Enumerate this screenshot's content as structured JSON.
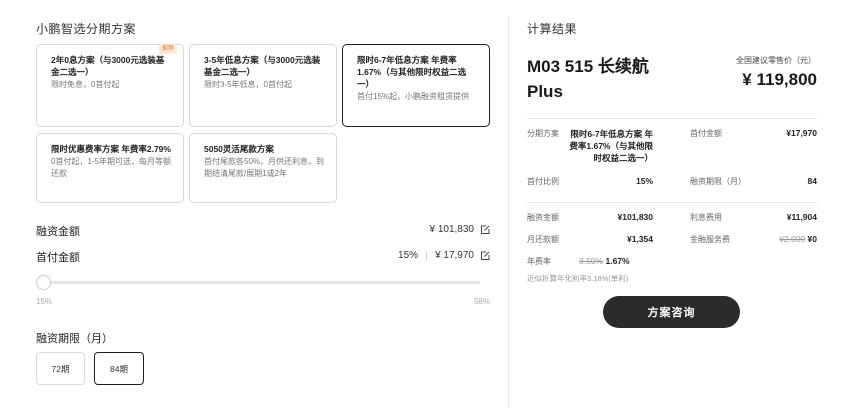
{
  "plans_section": {
    "title": "小鹏智选分期方案",
    "plans": [
      {
        "title": "2年0息方案（与3000元选装基金二选一）",
        "desc": "限时免息，0首付起",
        "badge": "推荐",
        "selected": false
      },
      {
        "title": "3-5年低息方案（与3000元选装基金二选一）",
        "desc": "限时3-5年低息，0首付起",
        "selected": false
      },
      {
        "title": "限时6-7年低息方案 年费率1.67%（与其他限时权益二选一）",
        "desc": "首付15%起，小鹏融资租赁提供",
        "selected": true
      },
      {
        "title": "限时优惠费率方案 年费率2.79%",
        "desc": "0首付起，1-5年期可选，每月等额还款",
        "selected": false
      },
      {
        "title": "5050灵活尾款方案",
        "desc": "首付尾款各50%，月供还利息，到期结清尾款/展期1或2年",
        "selected": false
      }
    ]
  },
  "financing": {
    "amount_label": "融资金额",
    "amount_value": "¥ 101,830",
    "down_label": "首付金额",
    "down_percent": "15%",
    "down_value": "¥ 17,970",
    "slider_level": 0,
    "slider_min": "15%",
    "slider_max": "58%"
  },
  "term": {
    "label": "融资期限（月）",
    "options": [
      "72期",
      "84期"
    ],
    "selected": "84期"
  },
  "result": {
    "title": "计算结果",
    "car_name": "M03 515 长续航 Plus",
    "price_label": "全国建议零售价（元）",
    "price_value": "¥ 119,800",
    "plan_label": "分期方案",
    "plan_value": "限时6-7年低息方案 年费率1.67%（与其他限时权益二选一）",
    "down_label": "首付金额",
    "down_value": "¥17,970",
    "ratio_label": "首付比例",
    "ratio_value": "15%",
    "term_label": "融资期限（月）",
    "term_value": "84",
    "fin_label": "融资金额",
    "fin_value": "¥101,830",
    "interest_label": "利息费用",
    "interest_value": "¥11,904",
    "monthly_label": "月还款额",
    "monthly_value": "¥1,354",
    "service_label": "金融服务费",
    "service_old": "¥2,000",
    "service_new": "¥0",
    "rate_label": "年费率",
    "rate_old": "3.50%",
    "rate_new": "1.67%",
    "note": "近似折算年化利率3.18%(单利)",
    "cta_label": "方案咨询"
  }
}
